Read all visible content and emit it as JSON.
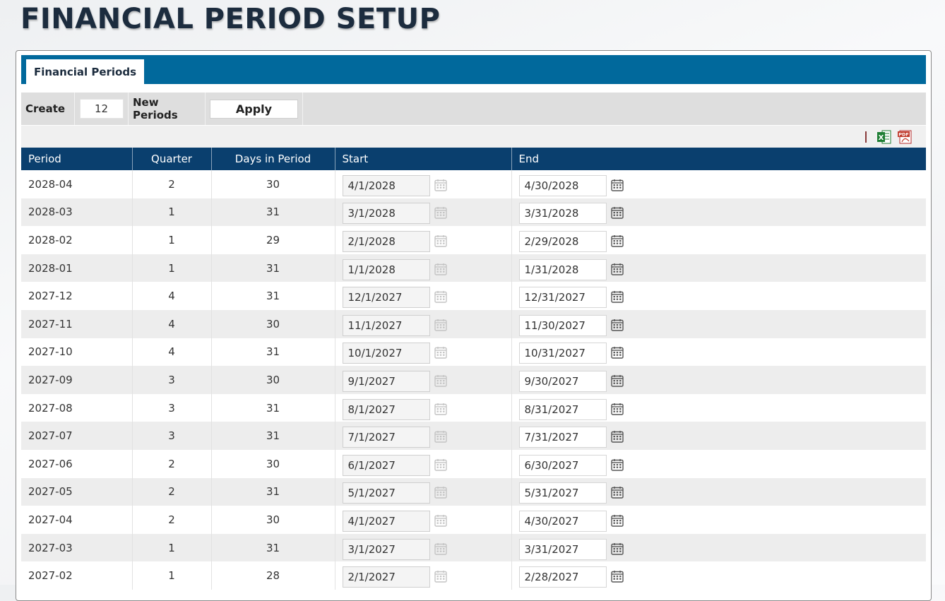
{
  "page": {
    "title": "FINANCIAL PERIOD SETUP"
  },
  "tabs": [
    {
      "label": "Financial Periods",
      "active": true
    }
  ],
  "toolbar": {
    "create_label": "Create",
    "count_value": "12",
    "new_periods_label": "New Periods",
    "apply_label": "Apply"
  },
  "export": {
    "excel_icon": "excel-icon",
    "pdf_icon": "pdf-icon"
  },
  "grid": {
    "columns": [
      "Period",
      "Quarter",
      "Days in Period",
      "Start",
      "End"
    ],
    "rows": [
      {
        "period": "2028-04",
        "quarter": "2",
        "days": "30",
        "start": "4/1/2028",
        "end": "4/30/2028"
      },
      {
        "period": "2028-03",
        "quarter": "1",
        "days": "31",
        "start": "3/1/2028",
        "end": "3/31/2028"
      },
      {
        "period": "2028-02",
        "quarter": "1",
        "days": "29",
        "start": "2/1/2028",
        "end": "2/29/2028"
      },
      {
        "period": "2028-01",
        "quarter": "1",
        "days": "31",
        "start": "1/1/2028",
        "end": "1/31/2028"
      },
      {
        "period": "2027-12",
        "quarter": "4",
        "days": "31",
        "start": "12/1/2027",
        "end": "12/31/2027"
      },
      {
        "period": "2027-11",
        "quarter": "4",
        "days": "30",
        "start": "11/1/2027",
        "end": "11/30/2027"
      },
      {
        "period": "2027-10",
        "quarter": "4",
        "days": "31",
        "start": "10/1/2027",
        "end": "10/31/2027"
      },
      {
        "period": "2027-09",
        "quarter": "3",
        "days": "30",
        "start": "9/1/2027",
        "end": "9/30/2027"
      },
      {
        "period": "2027-08",
        "quarter": "3",
        "days": "31",
        "start": "8/1/2027",
        "end": "8/31/2027"
      },
      {
        "period": "2027-07",
        "quarter": "3",
        "days": "31",
        "start": "7/1/2027",
        "end": "7/31/2027"
      },
      {
        "period": "2027-06",
        "quarter": "2",
        "days": "30",
        "start": "6/1/2027",
        "end": "6/30/2027"
      },
      {
        "period": "2027-05",
        "quarter": "2",
        "days": "31",
        "start": "5/1/2027",
        "end": "5/31/2027"
      },
      {
        "period": "2027-04",
        "quarter": "2",
        "days": "30",
        "start": "4/1/2027",
        "end": "4/30/2027"
      },
      {
        "period": "2027-03",
        "quarter": "1",
        "days": "31",
        "start": "3/1/2027",
        "end": "3/31/2027"
      },
      {
        "period": "2027-02",
        "quarter": "1",
        "days": "28",
        "start": "2/1/2027",
        "end": "2/28/2027"
      }
    ]
  },
  "colors": {
    "tabstrip": "#01699c",
    "header": "#0a3f6e",
    "title": "#1c2c3e"
  }
}
